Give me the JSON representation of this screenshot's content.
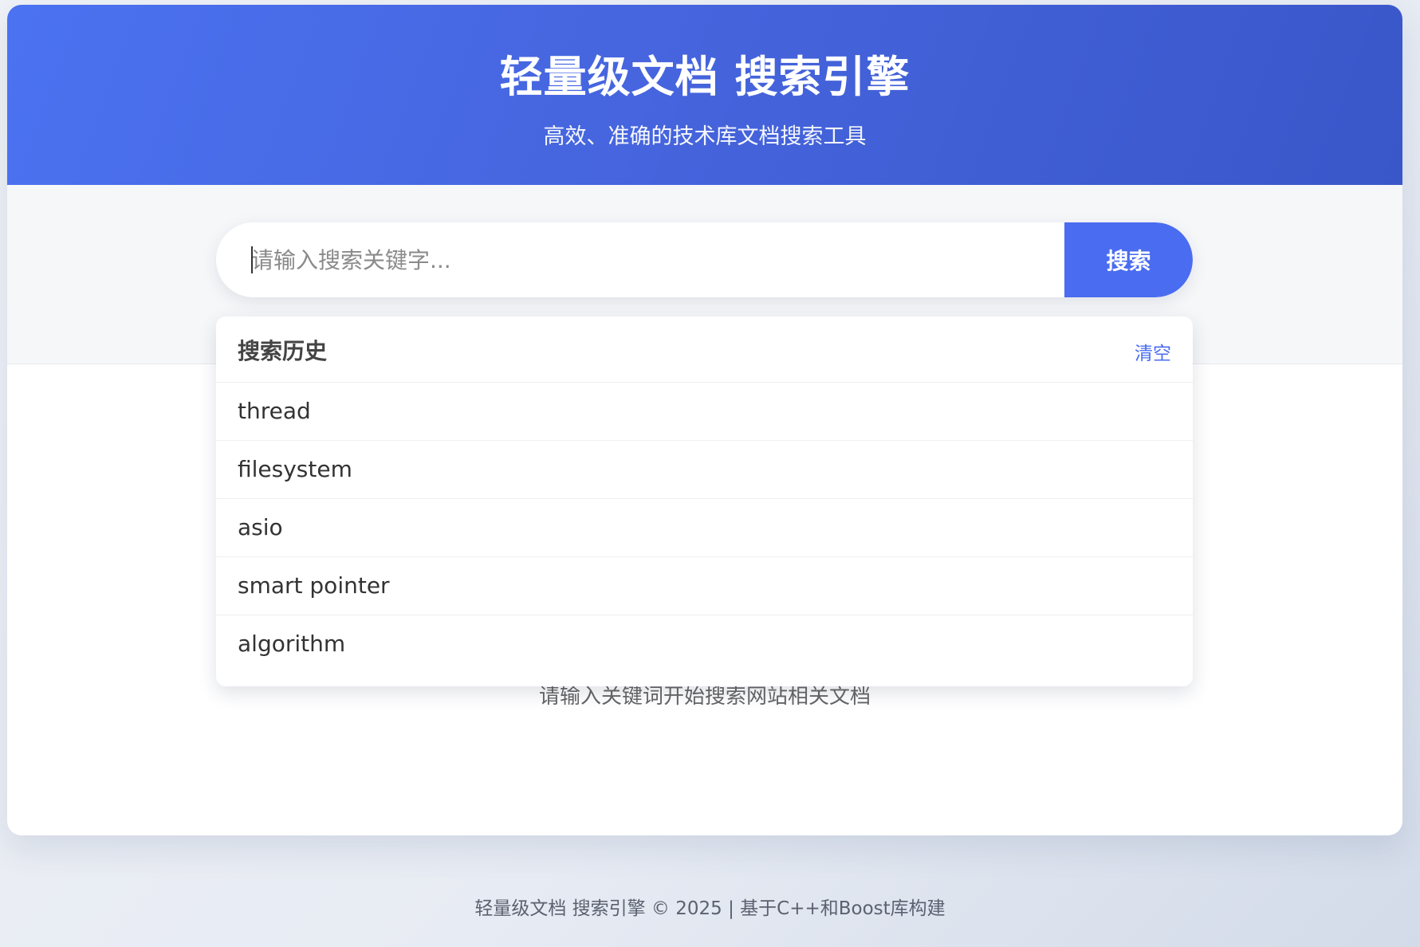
{
  "header": {
    "title": "轻量级文档 搜索引擎",
    "subtitle": "高效、准确的技术库文档搜索工具"
  },
  "search": {
    "placeholder": "请输入搜索关键字...",
    "value": "",
    "button_label": "搜索"
  },
  "history": {
    "title": "搜索历史",
    "clear_label": "清空",
    "items": [
      "thread",
      "filesystem",
      "asio",
      "smart pointer",
      "algorithm"
    ]
  },
  "empty_hint": "请输入关键词开始搜索网站相关文档",
  "footer": "轻量级文档 搜索引擎 © 2025 | 基于C++和Boost库构建",
  "colors": {
    "accent": "#4a6cf0",
    "header_start": "#4b72f1",
    "header_end": "#3a57c9"
  }
}
